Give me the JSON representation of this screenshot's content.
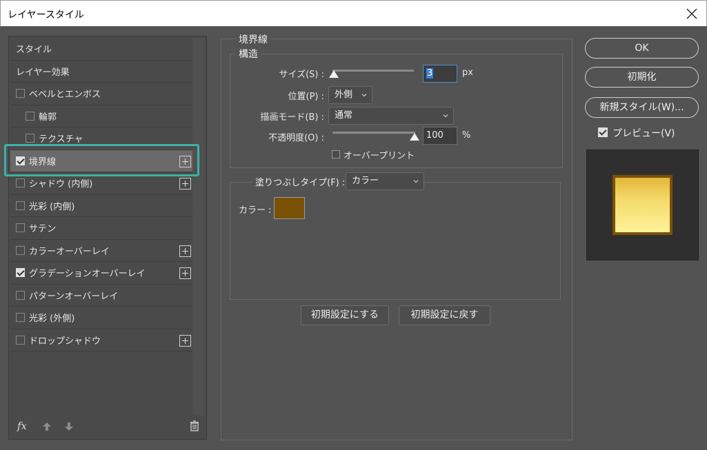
{
  "window": {
    "title": "レイヤースタイル"
  },
  "styles": {
    "items": [
      {
        "label": "スタイル",
        "checkbox": false,
        "checked": false,
        "plus": false,
        "sub": false
      },
      {
        "label": "レイヤー効果",
        "checkbox": false,
        "checked": false,
        "plus": false,
        "sub": false
      },
      {
        "label": "ベベルとエンボス",
        "checkbox": true,
        "checked": false,
        "plus": false,
        "sub": false
      },
      {
        "label": "輪郭",
        "checkbox": true,
        "checked": false,
        "plus": false,
        "sub": true
      },
      {
        "label": "テクスチャ",
        "checkbox": true,
        "checked": false,
        "plus": false,
        "sub": true
      },
      {
        "label": "境界線",
        "checkbox": true,
        "checked": true,
        "plus": true,
        "sub": false,
        "selected": true
      },
      {
        "label": "シャドウ (内側)",
        "checkbox": true,
        "checked": false,
        "plus": true,
        "sub": false
      },
      {
        "label": "光彩 (内側)",
        "checkbox": true,
        "checked": false,
        "plus": false,
        "sub": false
      },
      {
        "label": "サテン",
        "checkbox": true,
        "checked": false,
        "plus": false,
        "sub": false
      },
      {
        "label": "カラーオーバーレイ",
        "checkbox": true,
        "checked": false,
        "plus": true,
        "sub": false
      },
      {
        "label": "グラデーションオーバーレイ",
        "checkbox": true,
        "checked": true,
        "plus": true,
        "sub": false
      },
      {
        "label": "パターンオーバーレイ",
        "checkbox": true,
        "checked": false,
        "plus": false,
        "sub": false
      },
      {
        "label": "光彩 (外側)",
        "checkbox": true,
        "checked": false,
        "plus": false,
        "sub": false
      },
      {
        "label": "ドロップシャドウ",
        "checkbox": true,
        "checked": false,
        "plus": true,
        "sub": false
      }
    ],
    "footer": {
      "fx": "fx"
    }
  },
  "stroke": {
    "group_title": "境界線",
    "structure_title": "構造",
    "size_label": "サイズ(S) :",
    "size_value": "3",
    "size_unit": "px",
    "position_label": "位置(P) :",
    "position_value": "外側",
    "blend_label": "描画モード(B) :",
    "blend_value": "通常",
    "opacity_label": "不透明度(O) :",
    "opacity_value": "100",
    "opacity_unit": "%",
    "overprint_label": "オーバープリント",
    "fill_type_label": "塗りつぶしタイプ(F) :",
    "fill_type_value": "カラー",
    "color_label": "カラー :",
    "color_value": "#7a5206",
    "make_default": "初期設定にする",
    "reset_default": "初期設定に戻す"
  },
  "actions": {
    "ok": "OK",
    "reset": "初期化",
    "new_style": "新規スタイル(W)...",
    "preview_label": "プレビュー(V)"
  },
  "colors": {
    "accent": "#3bb3a5",
    "gold_dark": "#7a5206"
  }
}
